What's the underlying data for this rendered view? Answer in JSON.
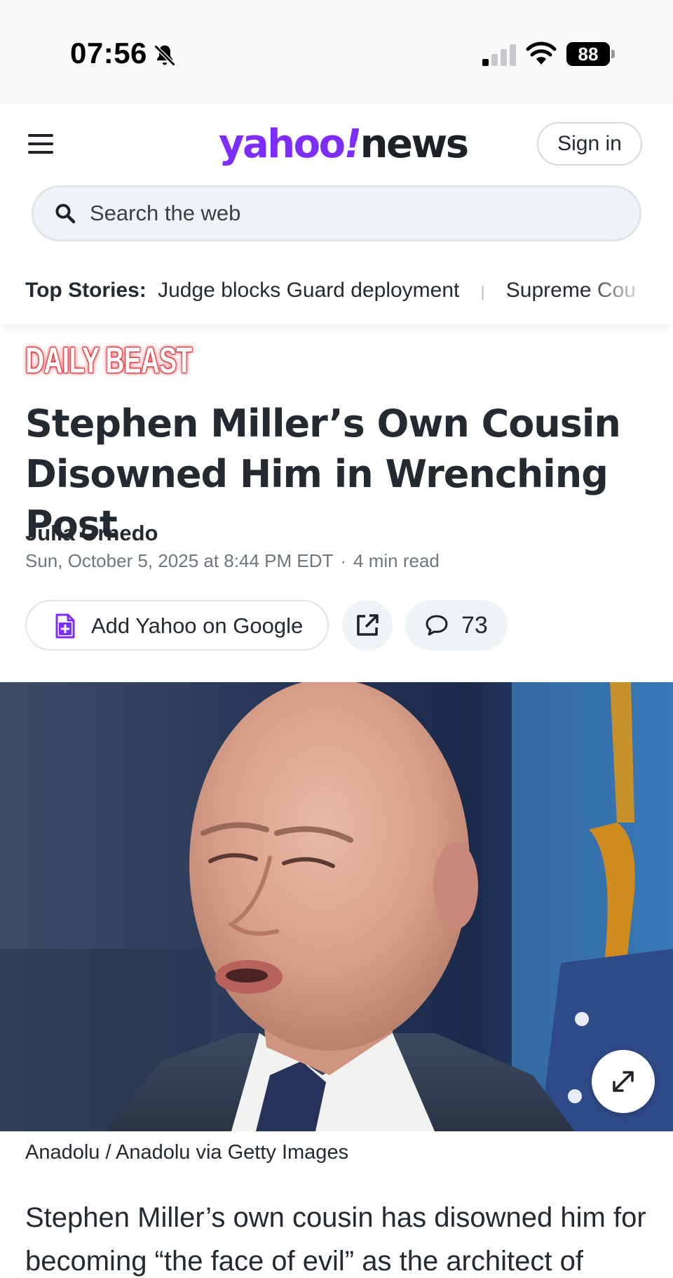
{
  "status_bar": {
    "time": "07:56",
    "battery": "88"
  },
  "header": {
    "logo_yahoo": "yahoo",
    "logo_bang": "!",
    "logo_news": "news",
    "sign_in_label": "Sign in",
    "search_placeholder": "Search the web"
  },
  "top_stories": {
    "label": "Top Stories:",
    "items": [
      "Judge blocks Guard deployment",
      "Supreme Cou"
    ]
  },
  "article": {
    "provider": "DAILY BEAST",
    "headline": "Stephen Miller’s Own Cousin Disowned Him in Wrenching Post",
    "author": "Julia Ornedo",
    "date": "Sun, October 5, 2025 at 8:44 PM EDT",
    "meta_separator": "·",
    "read_time": "4 min read",
    "add_google_label": "Add Yahoo on Google",
    "comment_count": "73",
    "image_caption": "Anadolu / Anadolu via Getty Images",
    "body_text": "Stephen Miller’s own cousin has disowned him for becoming “the face of evil” as the architect of"
  },
  "colors": {
    "brand_purple": "#7d2eff",
    "text_dark": "#232a31",
    "meta_gray": "#6e7780",
    "daily_beast_red": "#d8262a"
  },
  "icons": [
    "bell-slash-icon",
    "cellular-signal-icon",
    "wifi-icon",
    "battery-icon",
    "hamburger-menu-icon",
    "search-icon",
    "document-plus-icon",
    "share-external-icon",
    "comment-bubble-icon",
    "expand-icon"
  ]
}
